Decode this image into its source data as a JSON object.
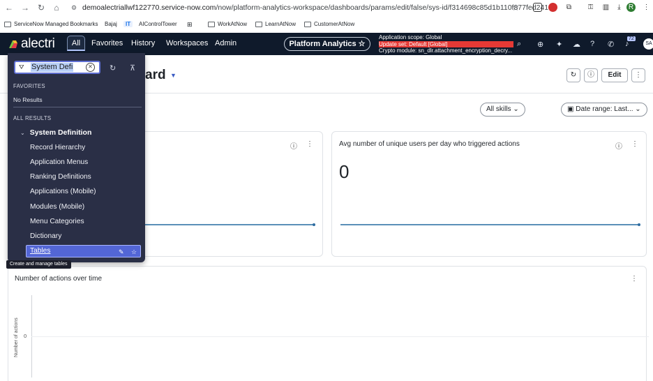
{
  "browser": {
    "url_domain": "demoalectriallwf122770.service-now.com",
    "url_path": "/now/platform-analytics-workspace/dashboards/params/edit/false/sys-id/f314698c85d1b110f877fed241...",
    "profile_initial": "R",
    "bookmarks": [
      {
        "label": "ServiceNow Managed Bookmarks"
      },
      {
        "label": "Bajaj"
      },
      {
        "label": "IT"
      },
      {
        "label": "AIControlTower"
      },
      {
        "label": "WorkAtNow"
      },
      {
        "label": "LearnAtNow"
      },
      {
        "label": "CustomerAtNow"
      }
    ]
  },
  "header": {
    "logo": "alectri",
    "menus": [
      "All",
      "Favorites",
      "History",
      "Workspaces",
      "Admin"
    ],
    "workspace_pill": "Platform Analytics ☆",
    "scope_line": "Application scope: Global",
    "update_set_line": "Update set: Default [Global]",
    "crypto_line": "Crypto module: sn_dlr.attachment_encryption_decry...",
    "notif_badge": "72",
    "avatar_initials": "SA"
  },
  "dashboard": {
    "title_fragment": "ard",
    "edit_label": "Edit",
    "filters": {
      "skills": "All skills",
      "date_range": "Date range: Last..."
    },
    "card2": {
      "title": "Avg number of unique users per day who triggered actions",
      "value": "0"
    },
    "card3": {
      "title": "Number of actions over time",
      "y_axis_label": "Number of actions",
      "y_tick": "0"
    }
  },
  "all_menu": {
    "filter_value": "System Defi",
    "favorites_header": "FAVORITES",
    "favorites_empty": "No Results",
    "all_results_header": "ALL RESULTS",
    "group_label": "System Definition",
    "items": [
      "Record Hierarchy",
      "Application Menus",
      "Ranking Definitions",
      "Applications (Mobile)",
      "Modules (Mobile)",
      "Menu Categories",
      "Dictionary",
      "Tables"
    ],
    "tooltip": "Create and manage tables"
  }
}
